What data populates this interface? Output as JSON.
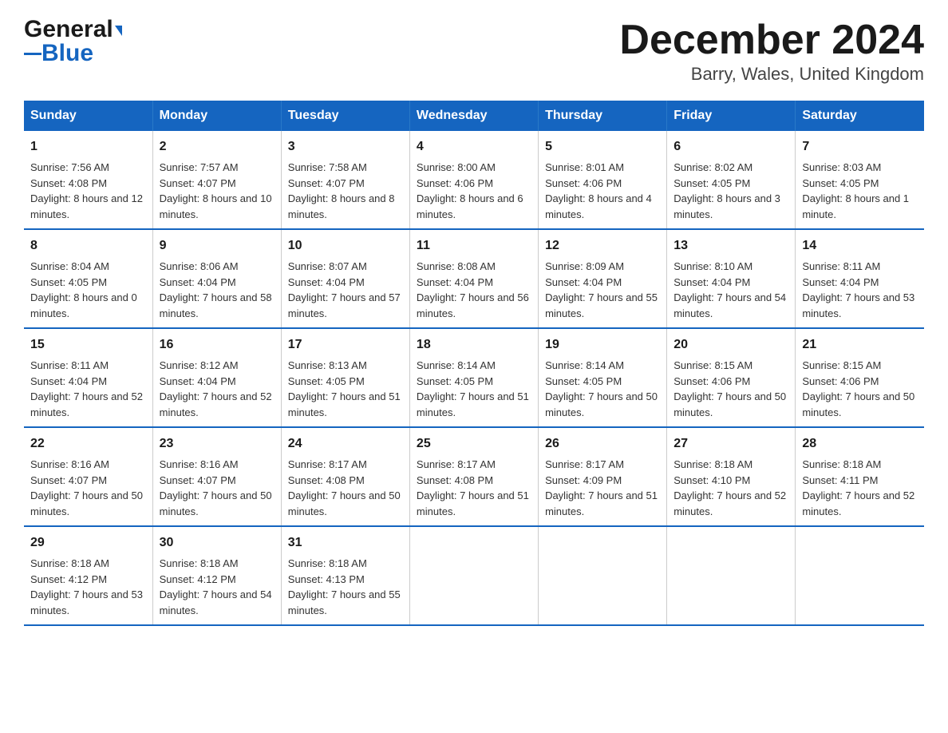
{
  "header": {
    "logo_general": "General",
    "logo_blue": "Blue",
    "month_title": "December 2024",
    "location": "Barry, Wales, United Kingdom"
  },
  "days_of_week": [
    "Sunday",
    "Monday",
    "Tuesday",
    "Wednesday",
    "Thursday",
    "Friday",
    "Saturday"
  ],
  "weeks": [
    [
      {
        "day": "1",
        "sunrise": "7:56 AM",
        "sunset": "4:08 PM",
        "daylight": "8 hours and 12 minutes."
      },
      {
        "day": "2",
        "sunrise": "7:57 AM",
        "sunset": "4:07 PM",
        "daylight": "8 hours and 10 minutes."
      },
      {
        "day": "3",
        "sunrise": "7:58 AM",
        "sunset": "4:07 PM",
        "daylight": "8 hours and 8 minutes."
      },
      {
        "day": "4",
        "sunrise": "8:00 AM",
        "sunset": "4:06 PM",
        "daylight": "8 hours and 6 minutes."
      },
      {
        "day": "5",
        "sunrise": "8:01 AM",
        "sunset": "4:06 PM",
        "daylight": "8 hours and 4 minutes."
      },
      {
        "day": "6",
        "sunrise": "8:02 AM",
        "sunset": "4:05 PM",
        "daylight": "8 hours and 3 minutes."
      },
      {
        "day": "7",
        "sunrise": "8:03 AM",
        "sunset": "4:05 PM",
        "daylight": "8 hours and 1 minute."
      }
    ],
    [
      {
        "day": "8",
        "sunrise": "8:04 AM",
        "sunset": "4:05 PM",
        "daylight": "8 hours and 0 minutes."
      },
      {
        "day": "9",
        "sunrise": "8:06 AM",
        "sunset": "4:04 PM",
        "daylight": "7 hours and 58 minutes."
      },
      {
        "day": "10",
        "sunrise": "8:07 AM",
        "sunset": "4:04 PM",
        "daylight": "7 hours and 57 minutes."
      },
      {
        "day": "11",
        "sunrise": "8:08 AM",
        "sunset": "4:04 PM",
        "daylight": "7 hours and 56 minutes."
      },
      {
        "day": "12",
        "sunrise": "8:09 AM",
        "sunset": "4:04 PM",
        "daylight": "7 hours and 55 minutes."
      },
      {
        "day": "13",
        "sunrise": "8:10 AM",
        "sunset": "4:04 PM",
        "daylight": "7 hours and 54 minutes."
      },
      {
        "day": "14",
        "sunrise": "8:11 AM",
        "sunset": "4:04 PM",
        "daylight": "7 hours and 53 minutes."
      }
    ],
    [
      {
        "day": "15",
        "sunrise": "8:11 AM",
        "sunset": "4:04 PM",
        "daylight": "7 hours and 52 minutes."
      },
      {
        "day": "16",
        "sunrise": "8:12 AM",
        "sunset": "4:04 PM",
        "daylight": "7 hours and 52 minutes."
      },
      {
        "day": "17",
        "sunrise": "8:13 AM",
        "sunset": "4:05 PM",
        "daylight": "7 hours and 51 minutes."
      },
      {
        "day": "18",
        "sunrise": "8:14 AM",
        "sunset": "4:05 PM",
        "daylight": "7 hours and 51 minutes."
      },
      {
        "day": "19",
        "sunrise": "8:14 AM",
        "sunset": "4:05 PM",
        "daylight": "7 hours and 50 minutes."
      },
      {
        "day": "20",
        "sunrise": "8:15 AM",
        "sunset": "4:06 PM",
        "daylight": "7 hours and 50 minutes."
      },
      {
        "day": "21",
        "sunrise": "8:15 AM",
        "sunset": "4:06 PM",
        "daylight": "7 hours and 50 minutes."
      }
    ],
    [
      {
        "day": "22",
        "sunrise": "8:16 AM",
        "sunset": "4:07 PM",
        "daylight": "7 hours and 50 minutes."
      },
      {
        "day": "23",
        "sunrise": "8:16 AM",
        "sunset": "4:07 PM",
        "daylight": "7 hours and 50 minutes."
      },
      {
        "day": "24",
        "sunrise": "8:17 AM",
        "sunset": "4:08 PM",
        "daylight": "7 hours and 50 minutes."
      },
      {
        "day": "25",
        "sunrise": "8:17 AM",
        "sunset": "4:08 PM",
        "daylight": "7 hours and 51 minutes."
      },
      {
        "day": "26",
        "sunrise": "8:17 AM",
        "sunset": "4:09 PM",
        "daylight": "7 hours and 51 minutes."
      },
      {
        "day": "27",
        "sunrise": "8:18 AM",
        "sunset": "4:10 PM",
        "daylight": "7 hours and 52 minutes."
      },
      {
        "day": "28",
        "sunrise": "8:18 AM",
        "sunset": "4:11 PM",
        "daylight": "7 hours and 52 minutes."
      }
    ],
    [
      {
        "day": "29",
        "sunrise": "8:18 AM",
        "sunset": "4:12 PM",
        "daylight": "7 hours and 53 minutes."
      },
      {
        "day": "30",
        "sunrise": "8:18 AM",
        "sunset": "4:12 PM",
        "daylight": "7 hours and 54 minutes."
      },
      {
        "day": "31",
        "sunrise": "8:18 AM",
        "sunset": "4:13 PM",
        "daylight": "7 hours and 55 minutes."
      },
      null,
      null,
      null,
      null
    ]
  ]
}
